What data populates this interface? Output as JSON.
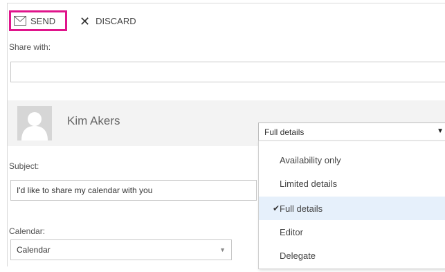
{
  "toolbar": {
    "send_label": "SEND",
    "discard_label": "DISCARD"
  },
  "share": {
    "label": "Share with:",
    "value": ""
  },
  "person": {
    "name": "Kim Akers",
    "permission": "Full details"
  },
  "subject": {
    "label": "Subject:",
    "value": "I'd like to share my calendar with you"
  },
  "calendar": {
    "label": "Calendar:",
    "value": "Calendar"
  },
  "permission_options": {
    "items": [
      {
        "label": "Availability only",
        "selected": false
      },
      {
        "label": "Limited details",
        "selected": false
      },
      {
        "label": "Full details",
        "selected": true
      },
      {
        "label": "Editor",
        "selected": false
      },
      {
        "label": "Delegate",
        "selected": false
      }
    ]
  },
  "colors": {
    "highlight_border": "#e0148b",
    "selected_option_bg": "#e6f0fb"
  },
  "icons": {
    "send": "send-icon",
    "discard": "close-icon",
    "avatar": "person-silhouette-icon",
    "dropdown": "chevron-down-icon",
    "check": "checkmark-icon"
  }
}
